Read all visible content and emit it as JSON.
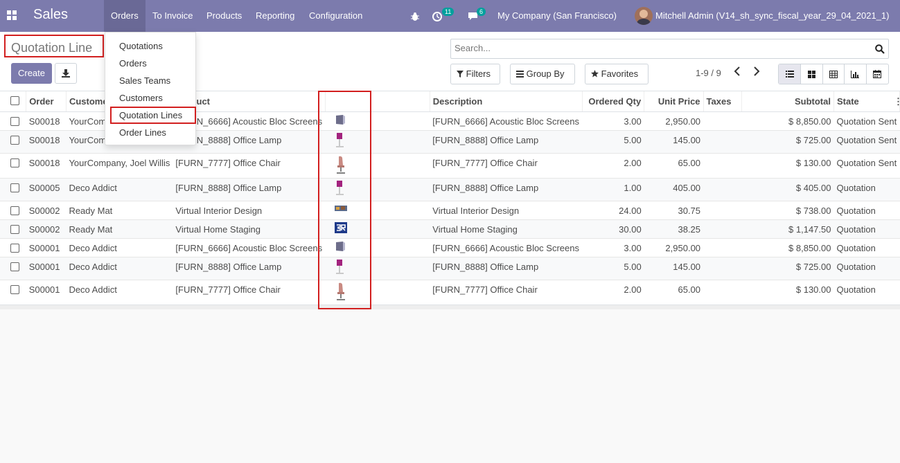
{
  "navbar": {
    "app_name": "Sales",
    "menu": [
      "Orders",
      "To Invoice",
      "Products",
      "Reporting",
      "Configuration"
    ],
    "activity_count": "11",
    "message_count": "6",
    "company": "My Company (San Francisco)",
    "user": "Mitchell Admin (V14_sh_sync_fiscal_year_29_04_2021_1)",
    "accent_color": "#7c7bad"
  },
  "control": {
    "breadcrumb": "Quotation Line",
    "create_label": "Create",
    "search_placeholder": "Search...",
    "filters_label": "Filters",
    "group_by_label": "Group By",
    "favorites_label": "Favorites",
    "pager": "1-9 / 9"
  },
  "dropdown": {
    "items": [
      "Quotations",
      "Orders",
      "Sales Teams",
      "Customers",
      "Quotation Lines",
      "Order Lines"
    ]
  },
  "table": {
    "headers": [
      "Order",
      "Customer",
      "Product",
      "",
      "Description",
      "Ordered Qty",
      "Unit Price",
      "Taxes",
      "Subtotal",
      "State"
    ],
    "rows": [
      {
        "order": "S00018",
        "customer": "YourCompany, Joel Willis",
        "product": "[FURN_6666] Acoustic Bloc Screens",
        "image": "screen-icon",
        "description": "[FURN_6666] Acoustic Bloc Screens",
        "qty": "3.00",
        "price": "2,950.00",
        "taxes": "",
        "subtotal": "$ 8,850.00",
        "state": "Quotation Sent"
      },
      {
        "order": "S00018",
        "customer": "YourCompany, Joel Willis",
        "product": "[FURN_8888] Office Lamp",
        "image": "lamp-icon",
        "description": "[FURN_8888] Office Lamp",
        "qty": "5.00",
        "price": "145.00",
        "taxes": "",
        "subtotal": "$ 725.00",
        "state": "Quotation Sent"
      },
      {
        "order": "S00018",
        "customer": "YourCompany, Joel Willis",
        "product": "[FURN_7777] Office Chair",
        "image": "chair-icon",
        "description": "[FURN_7777] Office Chair",
        "qty": "2.00",
        "price": "65.00",
        "taxes": "",
        "subtotal": "$ 130.00",
        "state": "Quotation Sent"
      },
      {
        "order": "S00005",
        "customer": "Deco Addict",
        "product": "[FURN_8888] Office Lamp",
        "image": "lamp-icon",
        "description": "[FURN_8888] Office Lamp",
        "qty": "1.00",
        "price": "405.00",
        "taxes": "",
        "subtotal": "$ 405.00",
        "state": "Quotation"
      },
      {
        "order": "S00002",
        "customer": "Ready Mat",
        "product": "Virtual Interior Design",
        "image": "design-icon",
        "description": "Virtual Interior Design",
        "qty": "24.00",
        "price": "30.75",
        "taxes": "",
        "subtotal": "$ 738.00",
        "state": "Quotation"
      },
      {
        "order": "S00002",
        "customer": "Ready Mat",
        "product": "Virtual Home Staging",
        "image": "staging-icon",
        "description": "Virtual Home Staging",
        "qty": "30.00",
        "price": "38.25",
        "taxes": "",
        "subtotal": "$ 1,147.50",
        "state": "Quotation"
      },
      {
        "order": "S00001",
        "customer": "Deco Addict",
        "product": "[FURN_6666] Acoustic Bloc Screens",
        "image": "screen-icon",
        "description": "[FURN_6666] Acoustic Bloc Screens",
        "qty": "3.00",
        "price": "2,950.00",
        "taxes": "",
        "subtotal": "$ 8,850.00",
        "state": "Quotation"
      },
      {
        "order": "S00001",
        "customer": "Deco Addict",
        "product": "[FURN_8888] Office Lamp",
        "image": "lamp-icon",
        "description": "[FURN_8888] Office Lamp",
        "qty": "5.00",
        "price": "145.00",
        "taxes": "",
        "subtotal": "$ 725.00",
        "state": "Quotation"
      },
      {
        "order": "S00001",
        "customer": "Deco Addict",
        "product": "[FURN_7777] Office Chair",
        "image": "chair-icon",
        "description": "[FURN_7777] Office Chair",
        "qty": "2.00",
        "price": "65.00",
        "taxes": "",
        "subtotal": "$ 130.00",
        "state": "Quotation"
      }
    ]
  }
}
